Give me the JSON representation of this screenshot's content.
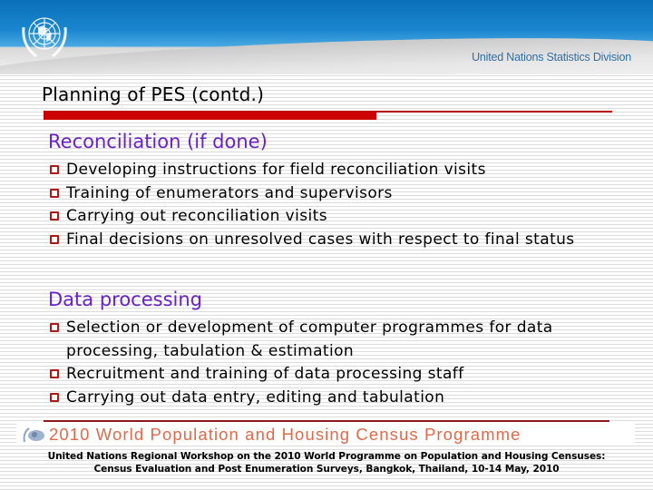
{
  "header": {
    "logo": "un-emblem-icon",
    "organization": "United Nations Statistics Division"
  },
  "slide": {
    "title": "Planning of PES (contd.)",
    "sections": [
      {
        "heading": "Reconciliation (if done)",
        "items": [
          "Developing instructions for field reconciliation visits",
          "Training of enumerators and supervisors",
          "Carrying out reconciliation visits",
          "Final decisions on unresolved cases with respect to  final status"
        ]
      },
      {
        "heading": "Data processing",
        "items": [
          "Selection or development of computer programmes for data processing, tabulation & estimation",
          "Recruitment and training of data processing staff",
          "Carrying out data entry, editing and tabulation"
        ]
      }
    ],
    "bullet_icon": "hollow-square-bullet-icon"
  },
  "footer": {
    "banner": "2010 World Population and Housing Census Programme",
    "banner_logo": "census-programme-logo-icon",
    "workshop_line1": "United Nations Regional Workshop on the 2010 World Programme on Population and Housing Censuses:",
    "workshop_line2": "Census Evaluation and Post Enumeration Surveys, Bangkok, Thailand, 10-14 May, 2010"
  },
  "colors": {
    "heading": "#6a22c8",
    "accent_red": "#cc0000",
    "header_blue": "#1a86cf",
    "banner_orange": "#e06a4a"
  }
}
